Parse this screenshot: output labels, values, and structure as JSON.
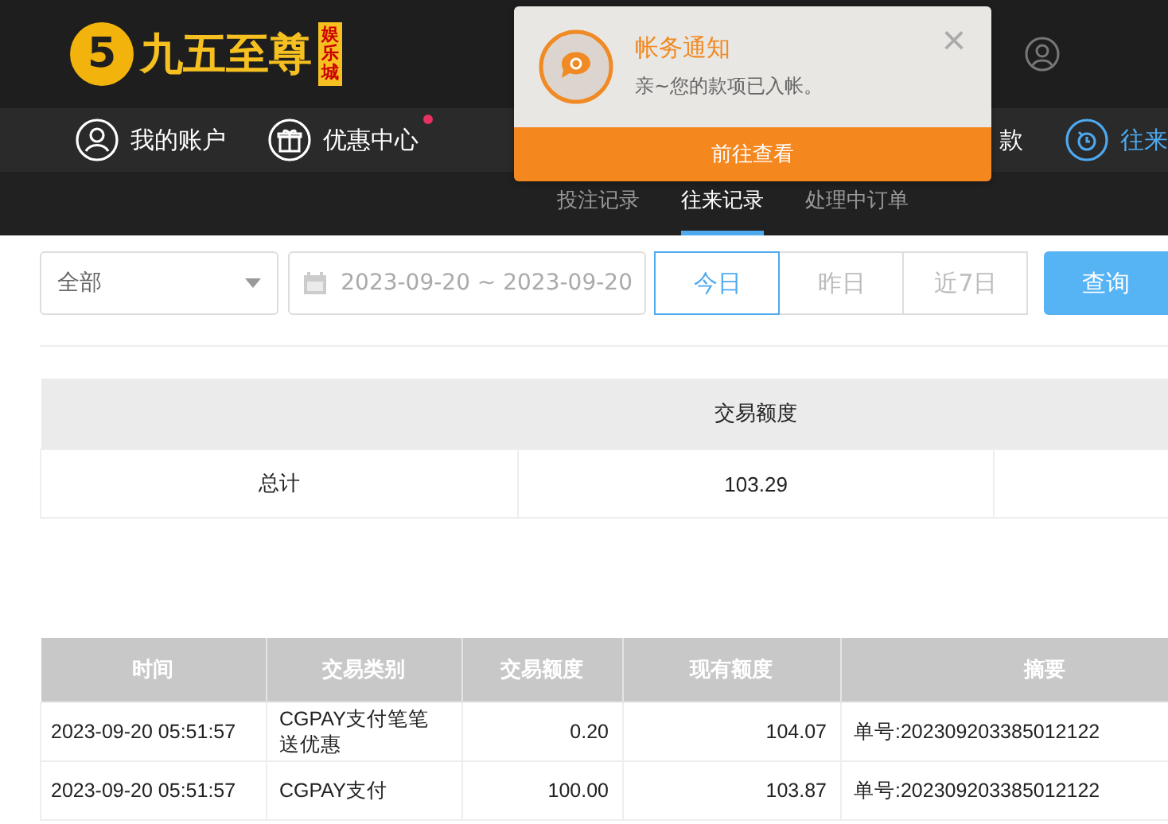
{
  "header": {
    "logo_numeral": "5",
    "logo_text": "九五至尊",
    "logo_badge": "娱乐城"
  },
  "nav": [
    {
      "label": "我的账户",
      "selected": false,
      "dot": false
    },
    {
      "label": "优惠中心",
      "selected": false,
      "dot": true
    },
    {
      "label": "款",
      "selected": false,
      "dot": false
    },
    {
      "label": "往来",
      "selected": true,
      "dot": false
    }
  ],
  "subtabs": [
    {
      "label": "投注记录",
      "selected": false
    },
    {
      "label": "往来记录",
      "selected": true
    },
    {
      "label": "处理中订单",
      "selected": false
    }
  ],
  "filters": {
    "type_select": "全部",
    "date_range": "2023-09-20 ~ 2023-09-20",
    "quick_ranges": [
      {
        "label": "今日",
        "selected": true
      },
      {
        "label": "昨日",
        "selected": false
      },
      {
        "label": "近7日",
        "selected": false
      }
    ],
    "query_button": "查询"
  },
  "summary": {
    "columns": [
      "",
      "交易额度",
      ""
    ],
    "rows": [
      [
        "总计",
        "103.29",
        ""
      ]
    ]
  },
  "table": {
    "columns": [
      "时间",
      "交易类别",
      "交易额度",
      "现有额度",
      "摘要"
    ],
    "rows": [
      [
        "2023-09-20 05:51:57",
        "CGPAY支付笔笔送优惠",
        "0.20",
        "104.07",
        "单号:202309203385012122"
      ],
      [
        "2023-09-20 05:51:57",
        "CGPAY支付",
        "100.00",
        "103.87",
        "单号:202309203385012122"
      ]
    ]
  },
  "notification": {
    "title": "帐务通知",
    "message": "亲~您的款项已入帐。",
    "close": "×",
    "action": "前往查看"
  }
}
